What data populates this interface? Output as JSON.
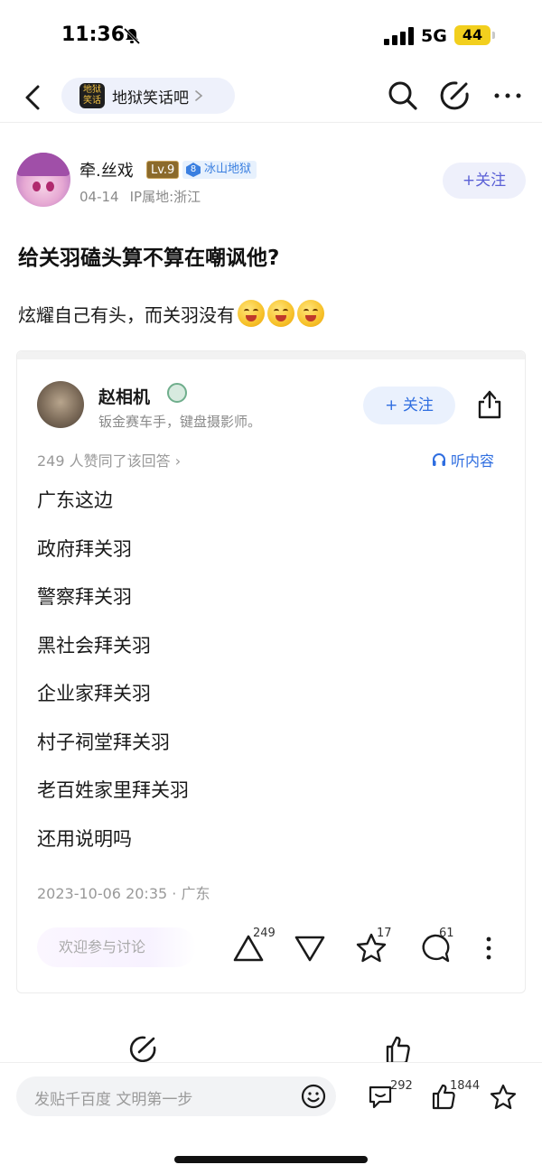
{
  "status_bar": {
    "time": "11:36",
    "network": "5G",
    "battery": "44"
  },
  "nav": {
    "forum_name": "地狱笑话吧",
    "forum_logo_text": "地狱笑话"
  },
  "post": {
    "author": {
      "name": "牵.丝戏",
      "level": "Lv.9",
      "tag_level": "8",
      "tag": "冰山地狱",
      "date": "04-14",
      "ip_location": "IP属地:浙江",
      "follow_label": "+关注"
    },
    "title": "给关羽磕头算不算在嘲讽他?",
    "body": "炫耀自己有头，而关羽没有",
    "emoji_count": 3
  },
  "embedded_answer": {
    "author_name": "赵相机",
    "author_bio": "钣金赛车手，键盘摄影师。",
    "follow_label": "+ 关注",
    "approve_text": "249 人赞同了该回答 ›",
    "listen_label": "听内容",
    "lines": [
      "广东这边",
      "政府拜关羽",
      "警察拜关羽",
      "黑社会拜关羽",
      "企业家拜关羽",
      "村子祠堂拜关羽",
      "老百姓家里拜关羽",
      "还用说明吗"
    ],
    "date": "2023-10-06 20:35 · 广东",
    "discuss_placeholder": "欢迎参与讨论",
    "upvotes": "249",
    "stars": "17",
    "comments": "61"
  },
  "bottom_bar": {
    "comment_placeholder": "发贴千百度 文明第一步",
    "comment_count": "292",
    "like_count": "1844"
  },
  "colors": {
    "accent_purple": "#5b61d6",
    "accent_blue": "#2f6ee0",
    "battery_yellow": "#f2cf1e",
    "level_badge": "#8b6a2b"
  }
}
